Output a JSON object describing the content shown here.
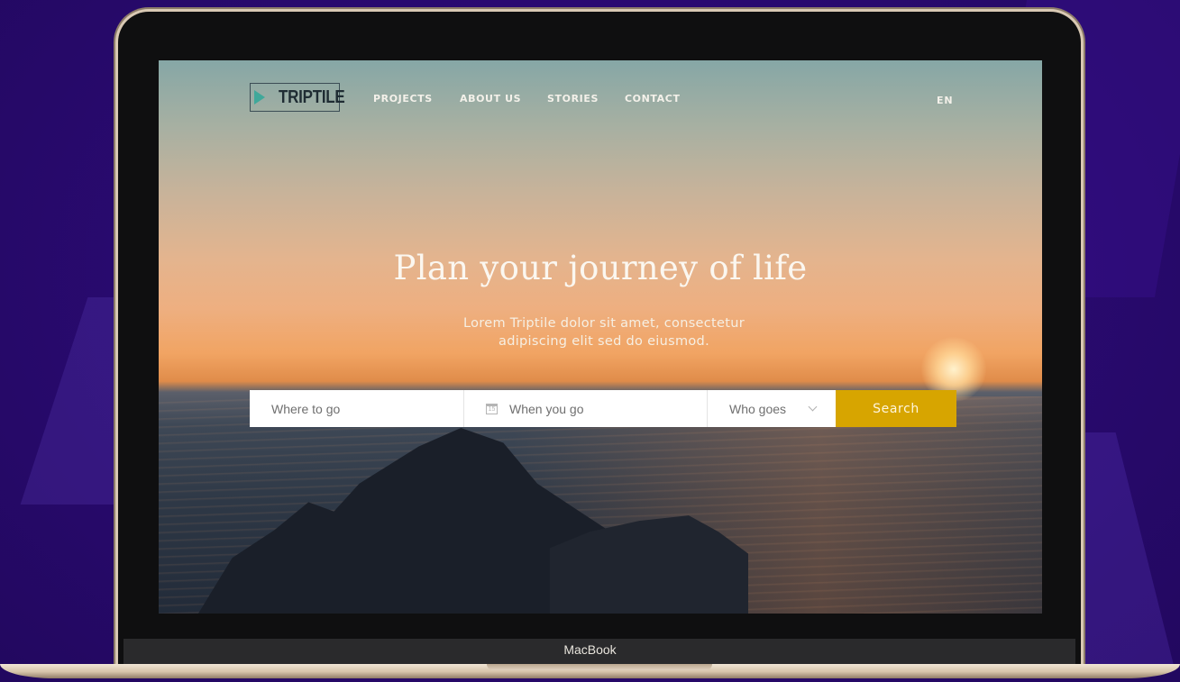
{
  "device": {
    "label": "MacBook"
  },
  "site": {
    "logo_text": "TRIPTILE",
    "nav": [
      {
        "label": "PROJECTS"
      },
      {
        "label": "ABOUT US"
      },
      {
        "label": "STORIES"
      },
      {
        "label": "CONTACT"
      }
    ],
    "language": "EN"
  },
  "hero": {
    "title": "Plan your journey of life",
    "subtitle_line1": "Lorem Triptile dolor sit amet, consectetur",
    "subtitle_line2": "adipiscing elit sed do eiusmod."
  },
  "search": {
    "where_placeholder": "Where to go",
    "when_placeholder": "When you go",
    "calendar_icon_digit": "15",
    "who_value": "Who goes",
    "button_label": "Search"
  },
  "colors": {
    "background": "#2a0a72",
    "accent": "#d7a500"
  },
  "icons": {
    "logo_mark": "play-triangle-icon",
    "calendar": "calendar-icon",
    "dropdown": "chevron-down-icon"
  }
}
